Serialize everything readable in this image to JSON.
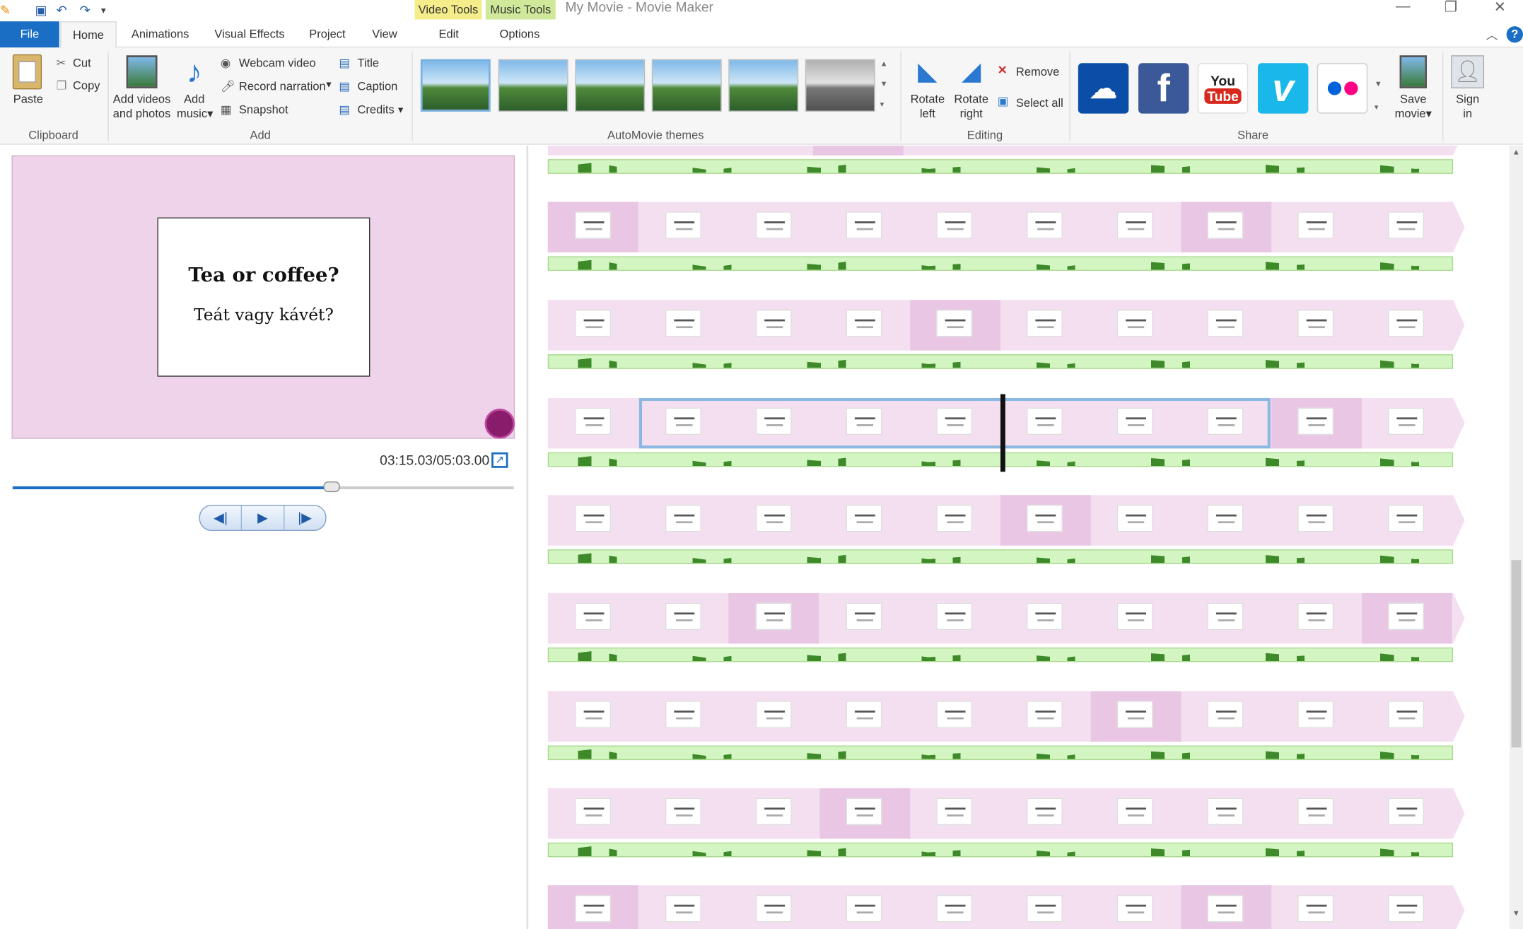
{
  "window": {
    "title": "My Movie - Movie Maker",
    "contextual_tabs": [
      "Video Tools",
      "Music Tools"
    ],
    "controls": [
      "minimize",
      "maximize",
      "close"
    ]
  },
  "ribbon_tabs": [
    "File",
    "Home",
    "Animations",
    "Visual Effects",
    "Project",
    "View",
    "Edit",
    "Options"
  ],
  "clipboard": {
    "paste": "Paste",
    "cut": "Cut",
    "copy": "Copy",
    "group": "Clipboard"
  },
  "add": {
    "add_videos_line1": "Add videos",
    "add_videos_line2": "and photos",
    "add_music_line1": "Add",
    "add_music_line2": "music",
    "webcam": "Webcam video",
    "narration": "Record narration",
    "snapshot": "Snapshot",
    "title": "Title",
    "caption": "Caption",
    "credits": "Credits",
    "group": "Add"
  },
  "themes": {
    "group": "AutoMovie themes"
  },
  "editing": {
    "rotate_left_1": "Rotate",
    "rotate_left_2": "left",
    "rotate_right_1": "Rotate",
    "rotate_right_2": "right",
    "remove": "Remove",
    "select_all": "Select all",
    "group": "Editing"
  },
  "share": {
    "group": "Share",
    "services": [
      "onedrive-icon",
      "facebook-icon",
      "youtube-icon",
      "vimeo-icon",
      "flickr-icon"
    ],
    "youtube_you": "You",
    "youtube_tube": "Tube",
    "facebook_letter": "f",
    "vimeo_letter": "v",
    "save_line1": "Save",
    "save_line2": "movie",
    "signin_line1": "Sign",
    "signin_line2": "in"
  },
  "preview": {
    "slide_title": "Tea or coffee?",
    "slide_subtitle": "Teát vagy kávét?",
    "timecode": "03:15.03/05:03.00",
    "progress": 0.65
  },
  "colors": {
    "file_tab": "#1a6ec4",
    "strip": "#f4dff0",
    "audio": "#d3f5c2",
    "selection": "#8ab8e0"
  }
}
